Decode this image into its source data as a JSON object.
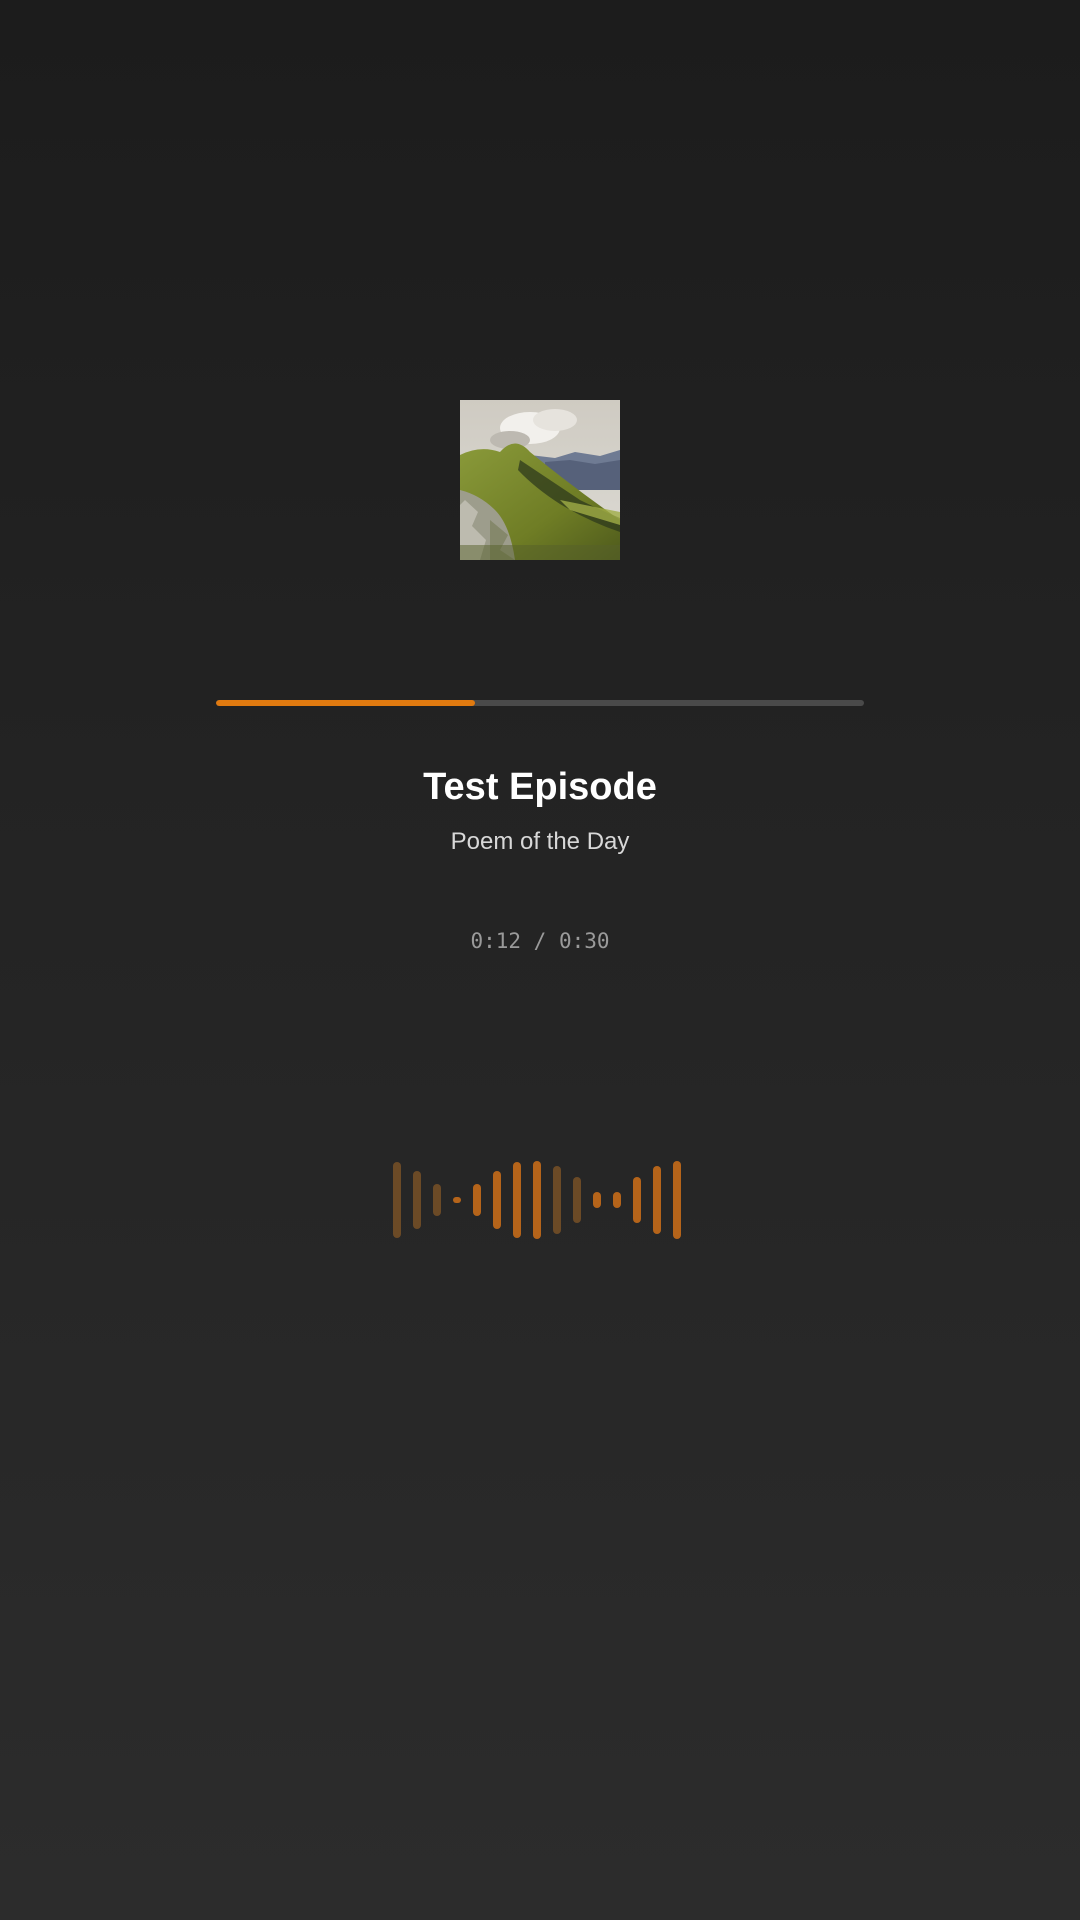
{
  "episode": {
    "title": "Test Episode",
    "show": "Poem of the Day"
  },
  "artwork": {
    "description": "mountain-landscape-image"
  },
  "playback": {
    "current_time": "0:12",
    "separator": " / ",
    "duration": "0:30",
    "progress_fraction": 0.4
  },
  "colors": {
    "accent": "#e07a10",
    "track": "#4a4a4a",
    "title": "#ffffff",
    "subtitle": "#d8d8d8",
    "time": "#9a9a9a",
    "bar_bright": "#b5641a",
    "bar_dim": "#6b4a26"
  },
  "visualizer": {
    "levels": [
      0.98,
      0.74,
      0.4,
      0.07,
      0.4,
      0.74,
      0.98,
      1.0,
      0.88,
      0.6,
      0.2,
      0.2,
      0.6,
      0.88,
      1.0
    ],
    "dim": [
      true,
      true,
      true,
      false,
      false,
      false,
      false,
      false,
      true,
      true,
      false,
      false,
      false,
      false,
      false
    ]
  }
}
